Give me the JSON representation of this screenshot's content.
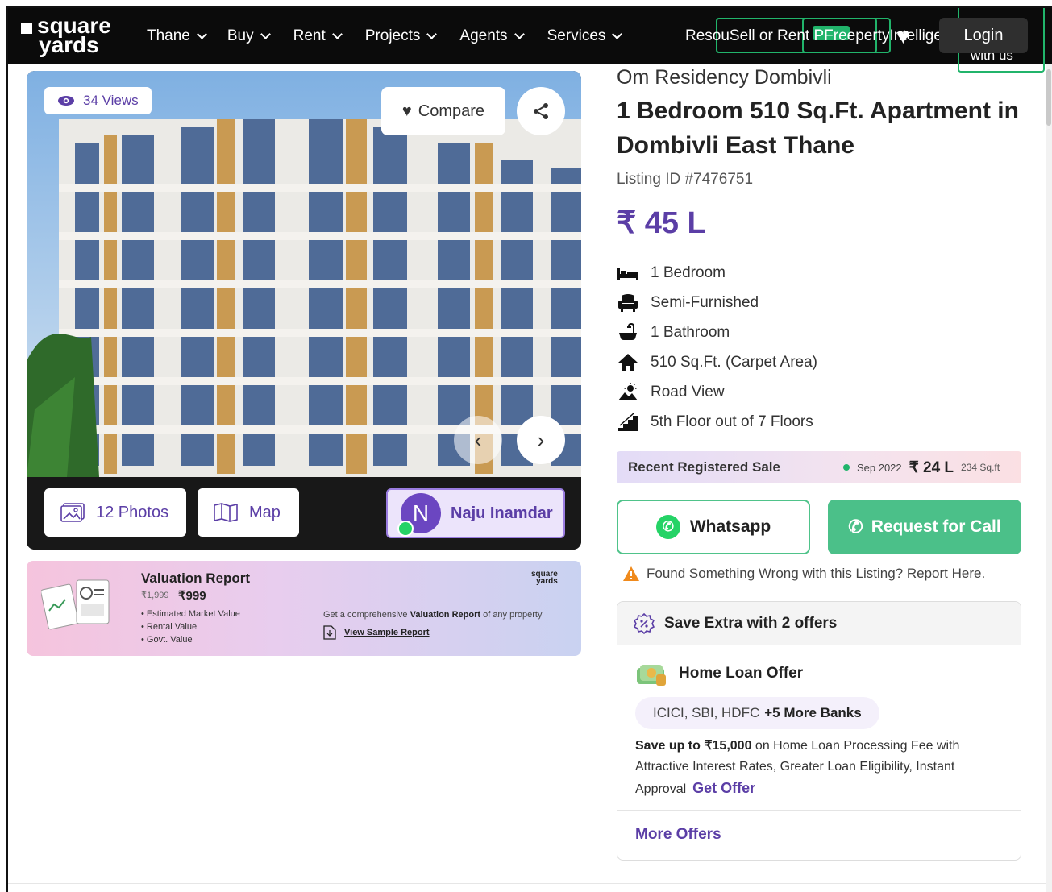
{
  "header": {
    "logo_line1": "square",
    "logo_line2": "yards",
    "nav": [
      {
        "label": "Thane"
      },
      {
        "label": "Buy"
      },
      {
        "label": "Rent"
      },
      {
        "label": "Projects"
      },
      {
        "label": "Agents"
      },
      {
        "label": "Services"
      }
    ],
    "overlap_text": "ResouSell or Rent PFreepertyIntelligence",
    "advertise": "Advertise with us",
    "login": "Login"
  },
  "gallery": {
    "views": "34 Views",
    "compare": "Compare",
    "photos": "12 Photos",
    "map": "Map",
    "agent_initial": "N",
    "agent_name": "Naju Inamdar"
  },
  "valuation": {
    "title": "Valuation Report",
    "old_price": "₹1,999",
    "new_price": "₹999",
    "bullets": [
      "Estimated Market Value",
      "Rental Value",
      "Govt. Value"
    ],
    "get_prefix": "Get a comprehensive ",
    "get_bold": "Valuation Report",
    "get_suffix": " of any property",
    "sample": "View Sample Report",
    "brand1": "square",
    "brand2": "yards"
  },
  "listing": {
    "project": "Om Residency Dombivli",
    "title": "1 Bedroom 510 Sq.Ft. Apartment in Dombivli East Thane",
    "listing_id": "Listing ID #7476751",
    "price": "₹ 45 L",
    "features": [
      {
        "icon": "bed-icon",
        "label": "1 Bedroom"
      },
      {
        "icon": "armchair-icon",
        "label": "Semi-Furnished"
      },
      {
        "icon": "bathtub-icon",
        "label": "1 Bathroom"
      },
      {
        "icon": "home-icon",
        "label": "510 Sq.Ft. (Carpet Area)"
      },
      {
        "icon": "sunrise-icon",
        "label": "Road View"
      },
      {
        "icon": "stairs-icon",
        "label": "5th Floor out of 7 Floors"
      }
    ],
    "recent_label": "Recent Registered Sale",
    "recent_date": "Sep 2022",
    "recent_price": "₹ 24 L",
    "recent_size": "234 Sq.ft",
    "whatsapp": "Whatsapp",
    "request_call": "Request for Call",
    "report_link": "Found Something Wrong with this Listing? Report Here."
  },
  "offers": {
    "header": "Save Extra with 2 offers",
    "home_loan_title": "Home Loan Offer",
    "banks": "ICICI, SBI, HDFC",
    "more_banks": "+5 More Banks",
    "desc_bold": "Save up to ₹15,000",
    "desc_rest": " on Home Loan Processing Fee with Attractive Interest Rates, Greater Loan Eligibility, Instant Approval",
    "get_offer": "Get Offer",
    "more_offers": "More Offers"
  },
  "colors": {
    "brand_purple": "#5b3ea6",
    "green": "#4bc089",
    "header_bg": "#0b0b0b"
  }
}
